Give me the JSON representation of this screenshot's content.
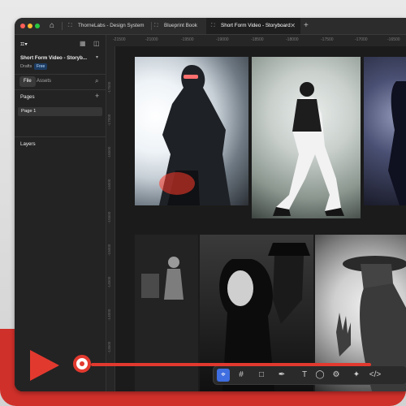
{
  "tabs": [
    {
      "label": "ThorneLabs - Design System"
    },
    {
      "label": "Blueprint Book"
    },
    {
      "label": "Short Form Video - Storyboard",
      "active": true
    }
  ],
  "icons": {
    "home": "home-icon",
    "tab_file": "figma-file-icon",
    "close": "close-icon",
    "plus": "plus-icon",
    "menu": "figma-menu-icon",
    "panel_toggle": "sidebar-toggle-icon",
    "search": "search-icon",
    "add": "plus-icon"
  },
  "panel": {
    "file_title": "Short Form Video - Storyb...",
    "location": "Drafts",
    "plan_badge": "Free",
    "tab_file": "File",
    "tab_assets": "Assets",
    "pages_header": "Pages",
    "page_1": "Page 1",
    "layers_header": "Layers"
  },
  "ruler": {
    "top": [
      "-21500",
      "-21000",
      "-19500",
      "-19000",
      "-18500",
      "-18000",
      "-17500",
      "-17000",
      "-16500"
    ],
    "left": [
      "-17500",
      "-17000",
      "-16500",
      "-16000",
      "-15500",
      "-15000",
      "-14500",
      "-14000",
      "-13500"
    ]
  },
  "toolbar": {
    "tools": [
      "move-tool",
      "frame-tool",
      "rectangle-tool",
      "pen-tool",
      "text-tool",
      "comment-tool",
      "actions-tool",
      "ai-tool",
      "dev-mode-tool"
    ],
    "glyphs": [
      "⌖",
      "#",
      "□",
      "✒",
      "T",
      "◯",
      "⚙",
      "✦",
      "</>"
    ]
  },
  "colors": {
    "accent": "#3f6ee0",
    "brand_red": "#e2392f",
    "badge_bg": "#1d3c63"
  },
  "progress": 0.12
}
